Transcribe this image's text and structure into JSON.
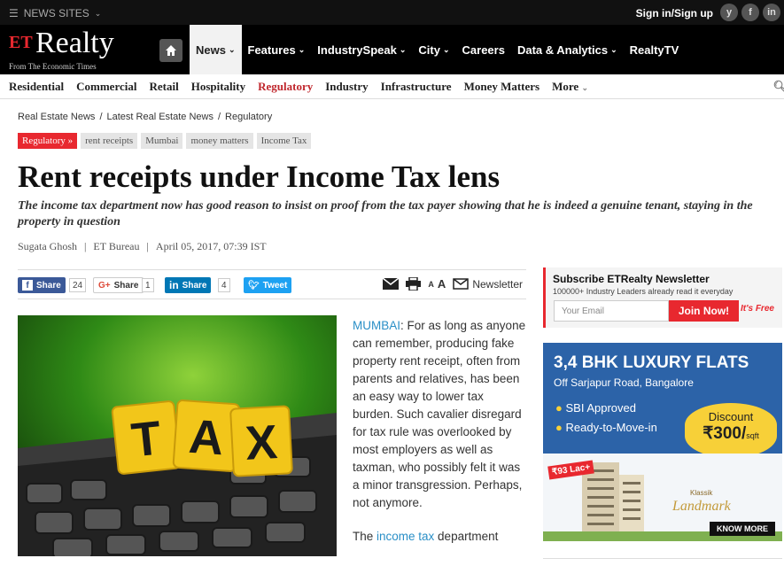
{
  "topbar": {
    "sites_label": "NEWS SITES",
    "signin": "Sign in/Sign up",
    "social": [
      "y",
      "f",
      "in"
    ]
  },
  "brand": {
    "et": "ET",
    "name": "Realty",
    "tagline": "From The Economic Times"
  },
  "mainnav": [
    {
      "label": "News",
      "dropdown": true,
      "active": true
    },
    {
      "label": "Features",
      "dropdown": true
    },
    {
      "label": "IndustrySpeak",
      "dropdown": true
    },
    {
      "label": "City",
      "dropdown": true
    },
    {
      "label": "Careers",
      "dropdown": false
    },
    {
      "label": "Data & Analytics",
      "dropdown": true
    },
    {
      "label": "RealtyTV",
      "dropdown": false
    }
  ],
  "subnav": [
    "Residential",
    "Commercial",
    "Retail",
    "Hospitality",
    "Regulatory",
    "Industry",
    "Infrastructure",
    "Money Matters",
    "More"
  ],
  "subnav_active": "Regulatory",
  "breadcrumb": [
    "Real Estate News",
    "Latest Real Estate News",
    "Regulatory"
  ],
  "tags": {
    "primary": "Regulatory »",
    "others": [
      "rent receipts",
      "Mumbai",
      "money matters",
      "Income Tax"
    ]
  },
  "article": {
    "title": "Rent receipts under Income Tax lens",
    "summary": "The income tax department now has good reason to insist on proof from the tax payer showing that he is indeed a genuine tenant, staying in the property in question",
    "author": "Sugata Ghosh",
    "source": "ET Bureau",
    "date": "April 05, 2017, 07:39 IST",
    "location": "MUMBAI",
    "para1": ": For as long as anyone can remember, producing fake property rent receipt, often from parents and relatives, has been an easy way to lower tax burden. Such cavalier disregard for tax rule was overlooked by most employers as well as taxman, who possibly felt it was a minor transgression. Perhaps, not anymore.",
    "para2_start": "The ",
    "para2_link": "income tax",
    "para2_end": " department",
    "image_word": "TAX"
  },
  "share": {
    "fb_label": "Share",
    "fb_count": "24",
    "gp_label": "Share",
    "gp_count": "1",
    "li_label": "Share",
    "li_count": "4",
    "tw_label": "Tweet",
    "font_small": "A",
    "font_large": "A",
    "newsletter": "Newsletter"
  },
  "newsletter_box": {
    "title": "Subscribe ETRealty Newsletter",
    "subtitle": "100000+ Industry Leaders already read it everyday",
    "placeholder": "Your Email",
    "join": "Join Now!",
    "free": "It's Free"
  },
  "ad": {
    "headline": "3,4 BHK LUXURY FLATS",
    "sub": "Off Sarjapur Road, Bangalore",
    "bullet1": "SBI Approved",
    "bullet2": "Ready-to-Move-in",
    "discount_label": "Discount",
    "discount_value": "₹300/",
    "discount_unit": "sqft",
    "price": "₹93 Lac+",
    "brand_small": "Klassik",
    "brand": "Landmark",
    "cta": "KNOW MORE"
  },
  "colors": {
    "accent": "#e8282f",
    "link": "#2a8fc7",
    "facebook": "#3b5998",
    "linkedin": "#0077b5",
    "twitter": "#1da1f2"
  }
}
